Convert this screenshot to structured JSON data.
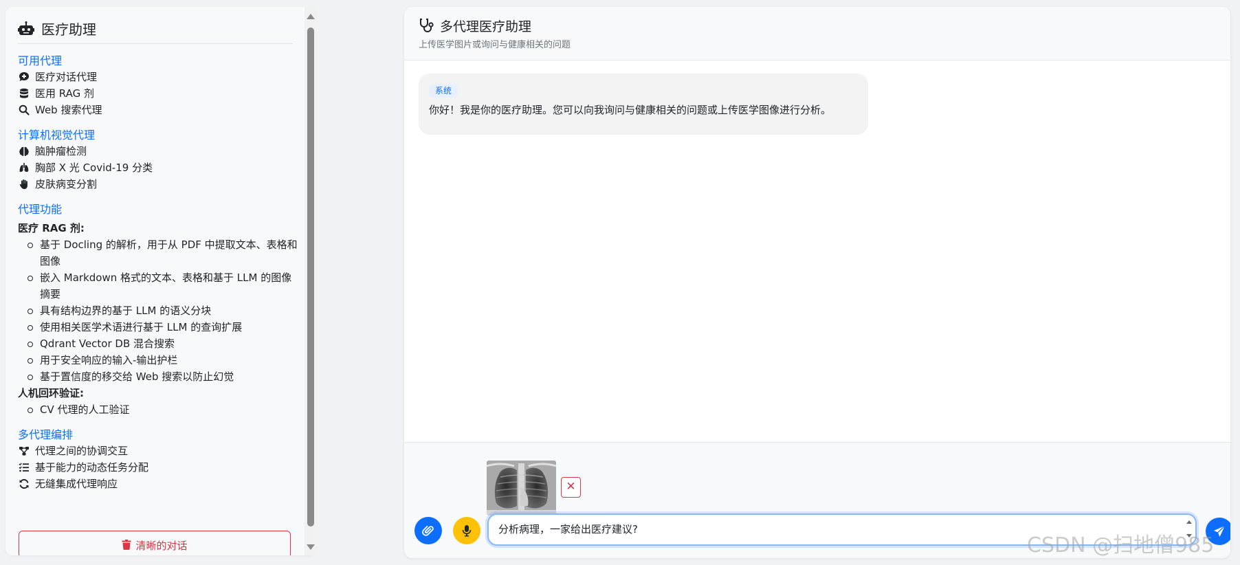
{
  "sidebar": {
    "title": "医疗助理",
    "sections": {
      "available_agents": {
        "heading": "可用代理",
        "items": [
          {
            "icon": "comment-medical-icon",
            "label": "医疗对话代理"
          },
          {
            "icon": "database-icon",
            "label": "医用 RAG 剂"
          },
          {
            "icon": "search-icon",
            "label": "Web 搜索代理"
          }
        ]
      },
      "cv_agents": {
        "heading": "计算机视觉代理",
        "items": [
          {
            "icon": "brain-icon",
            "label": "脑肿瘤检测"
          },
          {
            "icon": "lungs-icon",
            "label": "胸部 X 光 Covid-19 分类"
          },
          {
            "icon": "hand-icon",
            "label": "皮肤病变分割"
          }
        ]
      },
      "agent_features": {
        "heading": "代理功能",
        "rag_heading": "医疗 RAG 剂:",
        "rag_items": [
          "基于 Docling 的解析，用于从 PDF 中提取文本、表格和图像",
          "嵌入 Markdown 格式的文本、表格和基于 LLM 的图像摘要",
          "具有结构边界的基于 LLM 的语义分块",
          "使用相关医学术语进行基于 LLM 的查询扩展",
          "Qdrant Vector DB 混合搜索",
          "用于安全响应的输入-输出护栏",
          "基于置信度的移交给 Web 搜索以防止幻觉"
        ],
        "hitl_heading": "人机回环验证:",
        "hitl_items": [
          "CV 代理的人工验证"
        ]
      },
      "orchestration": {
        "heading": "多代理编排",
        "items": [
          {
            "icon": "diagram-icon",
            "label": "代理之间的协调交互"
          },
          {
            "icon": "list-check-icon",
            "label": "基于能力的动态任务分配"
          },
          {
            "icon": "sync-icon",
            "label": "无缝集成代理响应"
          }
        ]
      }
    },
    "clear_button": "清晰的对话"
  },
  "main": {
    "title": "多代理医疗助理",
    "subtitle": "上传医学图片或询问与健康相关的问题",
    "messages": [
      {
        "sender": "系统",
        "text": "你好！我是你的医疗助理。您可以向我询问与健康相关的问题或上传医学图像进行分析。"
      }
    ],
    "input": {
      "value": "分析病理，一家给出医疗建议?",
      "remove_label": "✕"
    }
  },
  "watermark": "CSDN @扫地僧985",
  "colors": {
    "accent": "#0d6efd",
    "danger": "#dc3545",
    "mic": "#ffc107"
  }
}
